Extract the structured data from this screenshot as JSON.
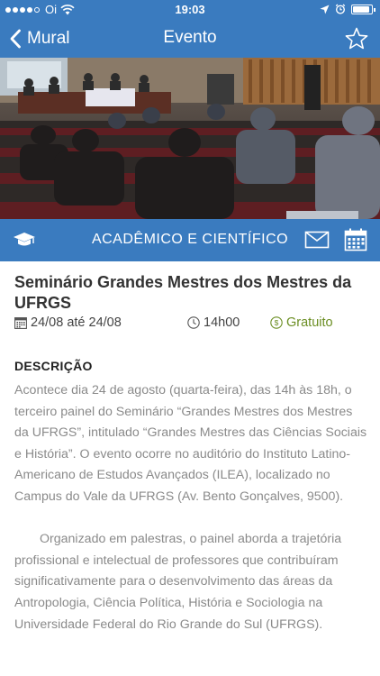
{
  "status_bar": {
    "carrier": "Oi",
    "time": "19:03"
  },
  "nav": {
    "back_label": "Mural",
    "title": "Evento"
  },
  "category": {
    "label": "ACADÊMICO E CIENTÍFICO"
  },
  "event": {
    "title": "Seminário Grandes Mestres dos Mestres da UFRGS",
    "date": "24/08 até 24/08",
    "time": "14h00",
    "price": "Gratuito"
  },
  "description": {
    "heading": "DESCRIÇÃO",
    "paragraph_1": "Acontece dia 24 de agosto (quarta-feira), das 14h às 18h, o terceiro painel do Seminário “Grandes Mestres dos Mestres da UFRGS”, intitulado “Grandes Mestres das Ciências Sociais e História”. O evento ocorre no auditório do Instituto Latino-Americano de Estudos Avançados (ILEA), localizado no Campus do Vale da UFRGS (Av. Bento Gonçalves, 9500).",
    "paragraph_2": "Organizado em palestras, o painel aborda a trajetória profissional e intelectual de professores que contribuíram significativamente para o desenvolvimento das áreas da Antropologia, Ciência Política, História e Sociologia na Universidade Federal do Rio Grande do Sul (UFRGS)."
  },
  "colors": {
    "brand_blue": "#3a7bbf",
    "free_green": "#6b8e23"
  }
}
